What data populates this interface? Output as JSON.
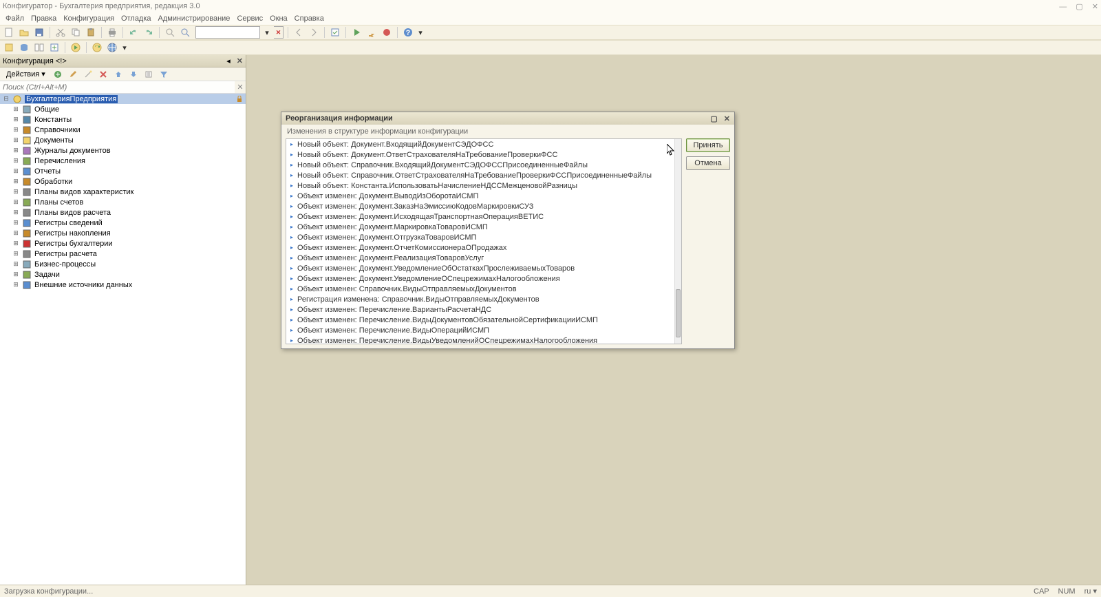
{
  "title": "Конфигуратор - Бухгалтерия предприятия, редакция 3.0",
  "menu": [
    "Файл",
    "Правка",
    "Конфигурация",
    "Отладка",
    "Администрирование",
    "Сервис",
    "Окна",
    "Справка"
  ],
  "side": {
    "title": "Конфигурация <!>",
    "actions_label": "Действия",
    "search_placeholder": "Поиск (Ctrl+Alt+M)",
    "root_label": "БухгалтерияПредприятия",
    "children": [
      "Общие",
      "Константы",
      "Справочники",
      "Документы",
      "Журналы документов",
      "Перечисления",
      "Отчеты",
      "Обработки",
      "Планы видов характеристик",
      "Планы счетов",
      "Планы видов расчета",
      "Регистры сведений",
      "Регистры накопления",
      "Регистры бухгалтерии",
      "Регистры расчета",
      "Бизнес-процессы",
      "Задачи",
      "Внешние источники данных"
    ]
  },
  "dialog": {
    "title": "Реорганизация информации",
    "subtitle": "Изменения в структуре информации конфигурации",
    "accept": "Принять",
    "cancel": "Отмена",
    "items": [
      "Новый объект: Документ.ВходящийДокументСЭДОФСС",
      "Новый объект: Документ.ОтветСтрахователяНаТребованиеПроверкиФСС",
      "Новый объект: Справочник.ВходящийДокументСЭДОФССПрисоединенныеФайлы",
      "Новый объект: Справочник.ОтветСтрахователяНаТребованиеПроверкиФССПрисоединенныеФайлы",
      "Новый объект: Константа.ИспользоватьНачислениеНДССМежценовойРазницы",
      "Объект изменен: Документ.ВыводИзОборотаИСМП",
      "Объект изменен: Документ.ЗаказНаЭмиссиюКодовМаркировкиСУЗ",
      "Объект изменен: Документ.ИсходящаяТранспортнаяОперацияВЕТИС",
      "Объект изменен: Документ.МаркировкаТоваровИСМП",
      "Объект изменен: Документ.ОтгрузкаТоваровИСМП",
      "Объект изменен: Документ.ОтчетКомиссионераОПродажах",
      "Объект изменен: Документ.РеализацияТоваровУслуг",
      "Объект изменен: Документ.УведомлениеОбОстаткахПрослеживаемыхТоваров",
      "Объект изменен: Документ.УведомлениеОСпецрежимахНалогообложения",
      "Объект изменен: Справочник.ВидыОтправляемыхДокументов",
      "Регистрация изменена: Справочник.ВидыОтправляемыхДокументов",
      "Объект изменен: Перечисление.ВариантыРасчетаНДС",
      "Объект изменен: Перечисление.ВидыДокументовОбязательнойСертификацииИСМП",
      "Объект изменен: Перечисление.ВидыОперацийИСМП",
      "Объект изменен: Перечисление.ВидыУведомленийОСпецрежимахНалогообложения"
    ]
  },
  "status": {
    "left": "Загрузка конфигурации...",
    "cap": "CAP",
    "num": "NUM",
    "lang": "ru ▾"
  },
  "colors": {
    "accent": "#d9d3bb",
    "select": "#2a5db0"
  }
}
